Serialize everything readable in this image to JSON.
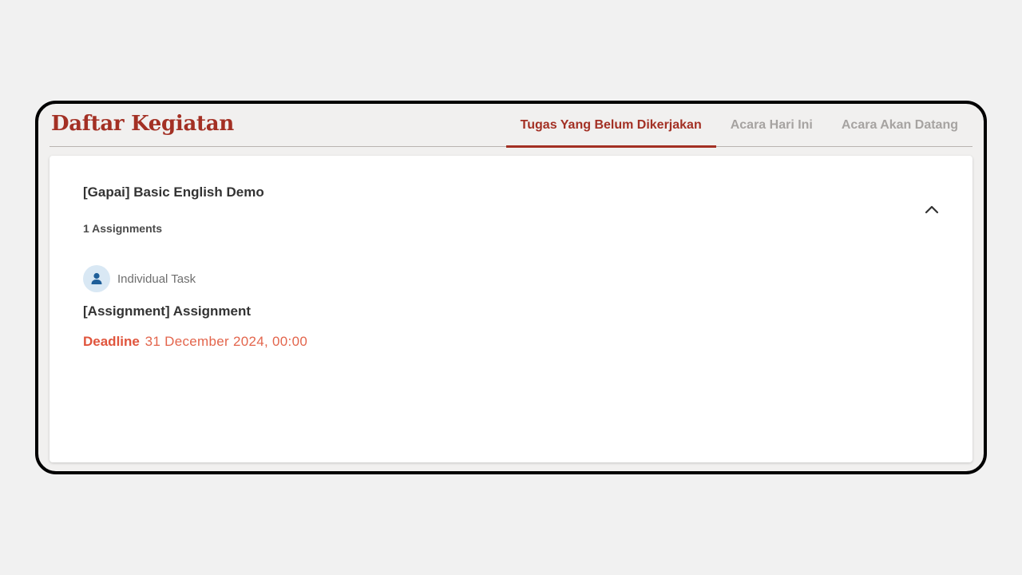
{
  "header": {
    "title": "Daftar Kegiatan",
    "tabs": [
      {
        "label": "Tugas Yang Belum Dikerjakan",
        "active": true
      },
      {
        "label": "Acara Hari Ini",
        "active": false
      },
      {
        "label": "Acara Akan Datang",
        "active": false
      }
    ]
  },
  "course": {
    "title": "[Gapai] Basic English Demo",
    "count": "1 Assignments",
    "collapse_icon": "chevron-up-icon"
  },
  "assignment": {
    "type_icon": "person-icon",
    "type_label": "Individual Task",
    "title": "[Assignment] Assignment",
    "deadline_label": "Deadline",
    "deadline_value": "31 December 2024, 00:00"
  },
  "colors": {
    "brand": "#a33024",
    "deadline": "#e0553d",
    "icon": "#1f5f99",
    "icon_bg": "#d9e8f4"
  }
}
